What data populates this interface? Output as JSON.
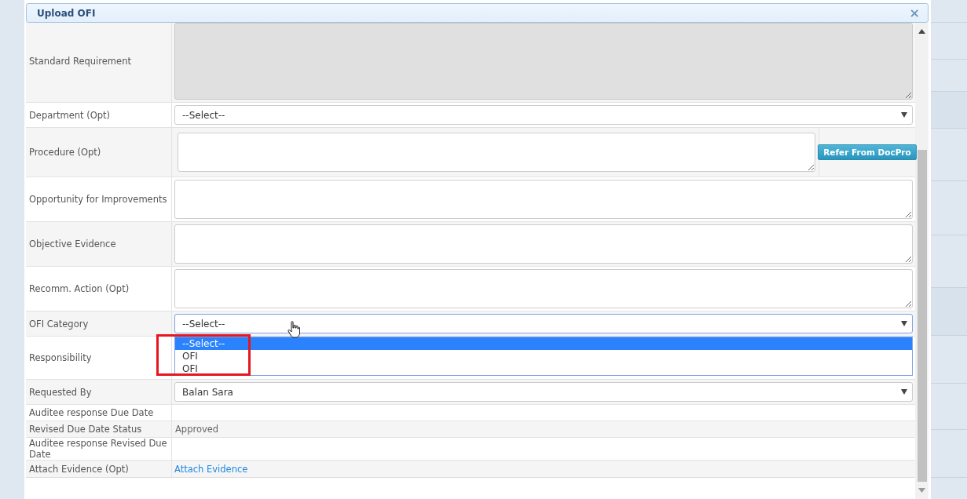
{
  "dialog": {
    "title": "Upload OFI",
    "close": "×"
  },
  "rows": [
    {
      "label": "Standard Requirement",
      "kind": "textarea",
      "disabled": true
    },
    {
      "label": "Department (Opt)",
      "kind": "select",
      "value": "--Select--"
    },
    {
      "label": "Procedure (Opt)",
      "kind": "textarea_button",
      "button": "Refer From DocPro"
    },
    {
      "label": "Opportunity for Improvements",
      "kind": "textarea",
      "disabled": false
    },
    {
      "label": "Objective Evidence",
      "kind": "textarea",
      "disabled": false
    },
    {
      "label": "Recomm. Action (Opt)",
      "kind": "textarea",
      "disabled": false
    },
    {
      "label": "OFI Category",
      "kind": "select",
      "value": "--Select--",
      "open": true,
      "options": [
        {
          "label": "--Select--",
          "selected": true
        },
        {
          "label": "OFI",
          "selected": false
        },
        {
          "label": "OFI",
          "selected": false
        }
      ]
    },
    {
      "label": "Responsibility",
      "kind": "covered"
    },
    {
      "label": "Requested By",
      "kind": "select",
      "value": "Balan Sara"
    },
    {
      "label": "Auditee response Due Date",
      "kind": "text"
    },
    {
      "label": "Revised Due Date Status",
      "kind": "text",
      "value": "Approved"
    },
    {
      "label": "Auditee response Revised Due Date",
      "kind": "text"
    },
    {
      "label": "Attach Evidence (Opt)",
      "kind": "link",
      "value": "Attach Evidence"
    }
  ]
}
